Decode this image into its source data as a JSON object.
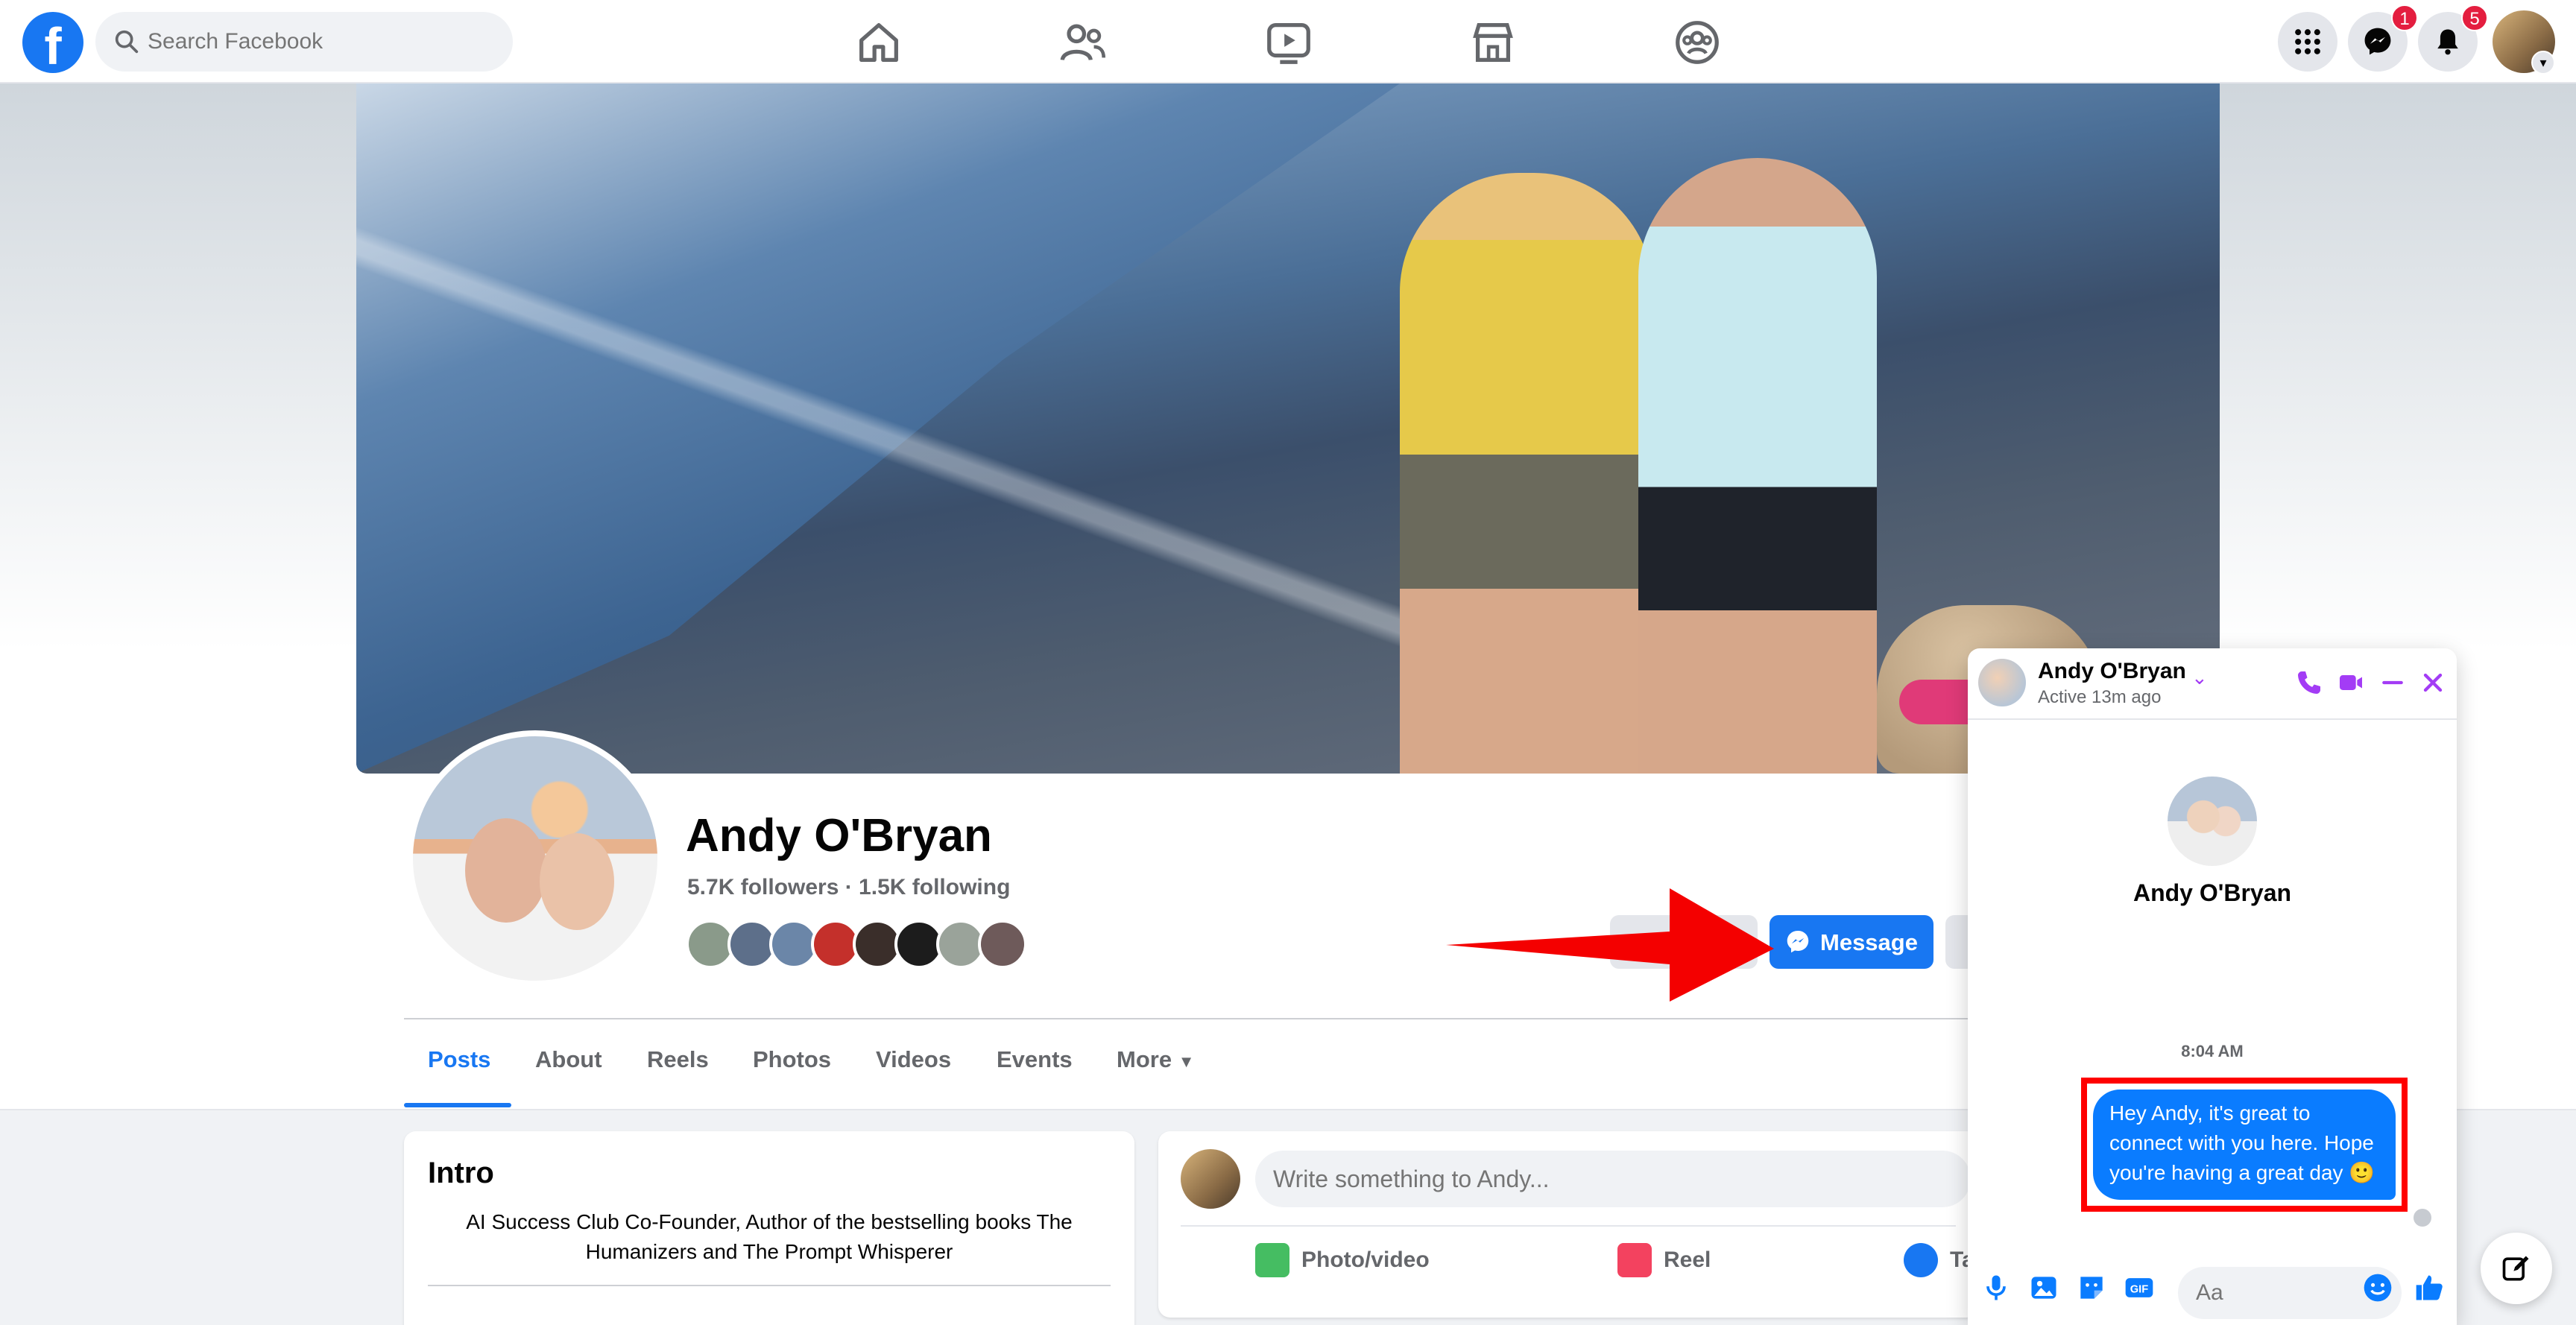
{
  "topbar": {
    "search_placeholder": "Search Facebook",
    "messenger_badge": "1",
    "notifications_badge": "5"
  },
  "profile": {
    "name": "Andy O'Bryan",
    "stats": "5.7K followers · 1.5K following",
    "message_button": "Message"
  },
  "tabs": [
    "Posts",
    "About",
    "Reels",
    "Photos",
    "Videos",
    "Events",
    "More"
  ],
  "intro": {
    "title": "Intro",
    "bio": "AI Success Club Co-Founder, Author of the bestselling books The Humanizers and The Prompt Whisperer"
  },
  "composer": {
    "placeholder": "Write something to Andy...",
    "actions": [
      "Photo/video",
      "Reel",
      "Ta"
    ]
  },
  "chat": {
    "name": "Andy O'Bryan",
    "status": "Active 13m ago",
    "big_name": "Andy O'Bryan",
    "time": "8:04 AM",
    "message": "Hey Andy, it's great to connect with you here. Hope you're having a great day 🙂",
    "input_placeholder": "Aa"
  },
  "colors": {
    "brand": "#1877f2",
    "messenger_accent": "#a33cf5",
    "bubble": "#0a7cff",
    "highlight": "#ff0000"
  }
}
